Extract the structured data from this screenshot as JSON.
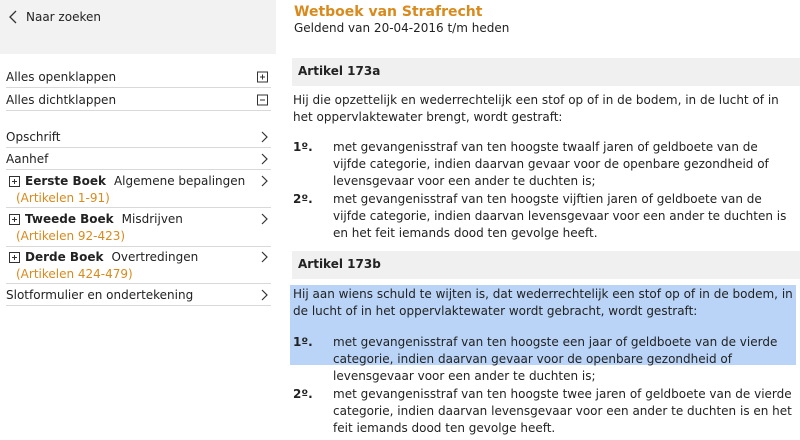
{
  "sidebar": {
    "back_label": "Naar zoeken",
    "expand_all": "Alles openklappen",
    "collapse_all": "Alles dichtklappen",
    "opschrift": "Opschrift",
    "aanhef": "Aanhef",
    "books": [
      {
        "name": "Eerste Boek",
        "subtitle": "Algemene bepalingen",
        "articles": "(Artikelen 1-91)"
      },
      {
        "name": "Tweede Boek",
        "subtitle": "Misdrijven",
        "articles": "(Artikelen 92-423)"
      },
      {
        "name": "Derde Boek",
        "subtitle": "Overtredingen",
        "articles": "(Artikelen 424-479)"
      }
    ],
    "slot": "Slotformulier en ondertekening"
  },
  "law": {
    "title": "Wetboek van Strafrecht",
    "valid": "Geldend van 20-04-2016 t/m heden"
  },
  "articles": [
    {
      "heading": "Artikel 173a",
      "intro": "Hij die opzettelijk en wederrechtelijk een stof op of in de bodem, in de lucht of in het oppervlaktewater brengt, wordt gestraft:",
      "items": [
        {
          "num": "1º.",
          "text": "met gevangenisstraf van ten hoogste twaalf jaren of geldboete van de vijfde categorie, indien daarvan gevaar voor de openbare gezondheid of levensgevaar voor een ander te duchten is;"
        },
        {
          "num": "2º.",
          "text": "met gevangenisstraf van ten hoogste vijftien jaren of geldboete van de vijfde categorie, indien daarvan levensgevaar voor een ander te duchten is en het feit iemands dood ten gevolge heeft."
        }
      ]
    },
    {
      "heading": "Artikel 173b",
      "intro": "Hij aan wiens schuld te wijten is, dat wederrechtelijk een stof op of in de bodem, in de lucht of in het oppervlaktewater wordt gebracht, wordt gestraft:",
      "items": [
        {
          "num": "1º.",
          "text": "met gevangenisstraf van ten hoogste een jaar of geldboete van de vierde categorie, indien daarvan gevaar voor de openbare gezondheid of levensgevaar voor een ander te duchten is;"
        },
        {
          "num": "2º.",
          "text": "met gevangenisstraf van ten hoogste twee jaren of geldboete van de vierde categorie, indien daarvan levensgevaar voor een ander te duchten is en het feit iemands dood ten gevolge heeft."
        }
      ]
    }
  ],
  "colors": {
    "accent": "#d98a1c",
    "highlight": "#b9d4f7",
    "header_bg": "#f0f0f0"
  }
}
